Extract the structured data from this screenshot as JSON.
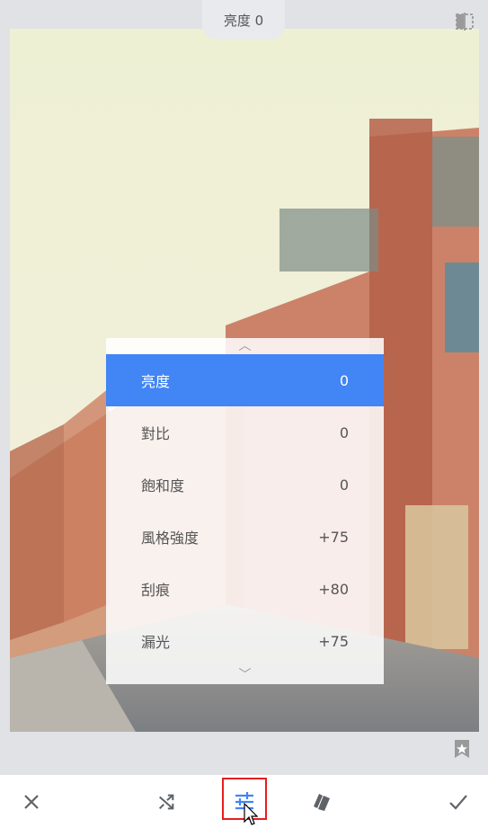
{
  "header": {
    "title": "亮度 0"
  },
  "menu": {
    "items": [
      {
        "label": "亮度",
        "value": "0"
      },
      {
        "label": "對比",
        "value": "0"
      },
      {
        "label": "飽和度",
        "value": "0"
      },
      {
        "label": "風格強度",
        "value": "+75"
      },
      {
        "label": "刮痕",
        "value": "+80"
      },
      {
        "label": "漏光",
        "value": "+75"
      }
    ],
    "active_index": 0
  },
  "colors": {
    "accent": "#4285f4",
    "highlight_border": "#e41f1f"
  },
  "icons": [
    "compare-icon",
    "star-bookmark-icon",
    "close-icon",
    "shuffle-icon",
    "sliders-icon",
    "style-cards-icon",
    "check-icon",
    "mouse-cursor-icon"
  ]
}
